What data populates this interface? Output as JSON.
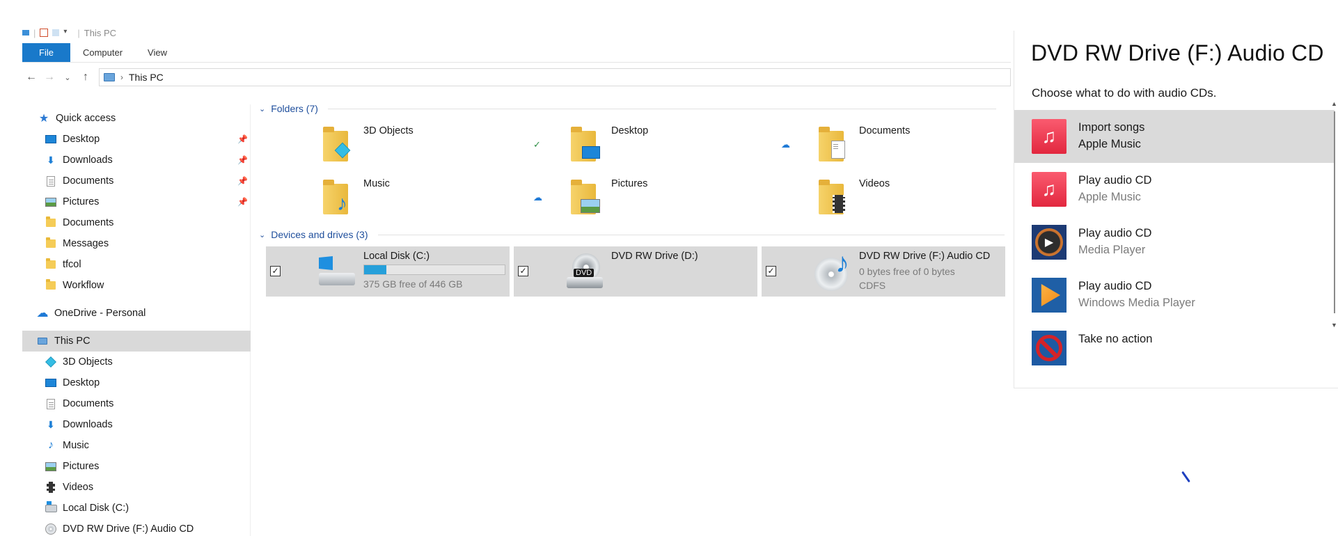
{
  "titlebar": {
    "title": "This PC"
  },
  "ribbon": {
    "tabs": [
      "File",
      "Computer",
      "View"
    ]
  },
  "address": {
    "path": "This PC"
  },
  "sidebar": {
    "quick_access": "Quick access",
    "quick_items": [
      "Desktop",
      "Downloads",
      "Documents",
      "Pictures",
      "Documents",
      "Messages",
      "tfcol",
      "Workflow"
    ],
    "onedrive": "OneDrive - Personal",
    "this_pc": "This PC",
    "pc_items": [
      "3D Objects",
      "Desktop",
      "Documents",
      "Downloads",
      "Music",
      "Pictures",
      "Videos",
      "Local Disk (C:)",
      "DVD RW Drive (F:) Audio CD"
    ]
  },
  "folders": {
    "header": "Folders (7)",
    "items": [
      "3D Objects",
      "Desktop",
      "Documents",
      "Music",
      "Pictures",
      "Videos"
    ]
  },
  "drives": {
    "header": "Devices and drives (3)",
    "items": [
      {
        "name": "Local Disk (C:)",
        "sub1": "375 GB free of 446 GB",
        "used_fraction": 0.16
      },
      {
        "name": "DVD RW Drive (D:)",
        "badge": "DVD"
      },
      {
        "name": "DVD RW Drive (F:) Audio CD",
        "sub1": "0 bytes free of 0 bytes",
        "sub2": "CDFS"
      }
    ]
  },
  "autoplay": {
    "title": "DVD RW Drive (F:) Audio CD",
    "subtitle": "Choose what to do with audio CDs.",
    "options": [
      {
        "line1": "Import songs",
        "line2": "Apple Music",
        "icon": "apple-music-icon"
      },
      {
        "line1": "Play audio CD",
        "line2": "Apple Music",
        "icon": "apple-music-icon"
      },
      {
        "line1": "Play audio CD",
        "line2": "Media Player",
        "icon": "media-player-icon"
      },
      {
        "line1": "Play audio CD",
        "line2": "Windows Media Player",
        "icon": "windows-media-player-icon"
      },
      {
        "line1": "Take no action",
        "line2": "",
        "icon": "no-action-icon"
      }
    ]
  },
  "colors": {
    "accent": "#1979ca",
    "selection": "#d9d9d9",
    "link": "#1e4e9c",
    "apple_music": "#f23a52"
  }
}
